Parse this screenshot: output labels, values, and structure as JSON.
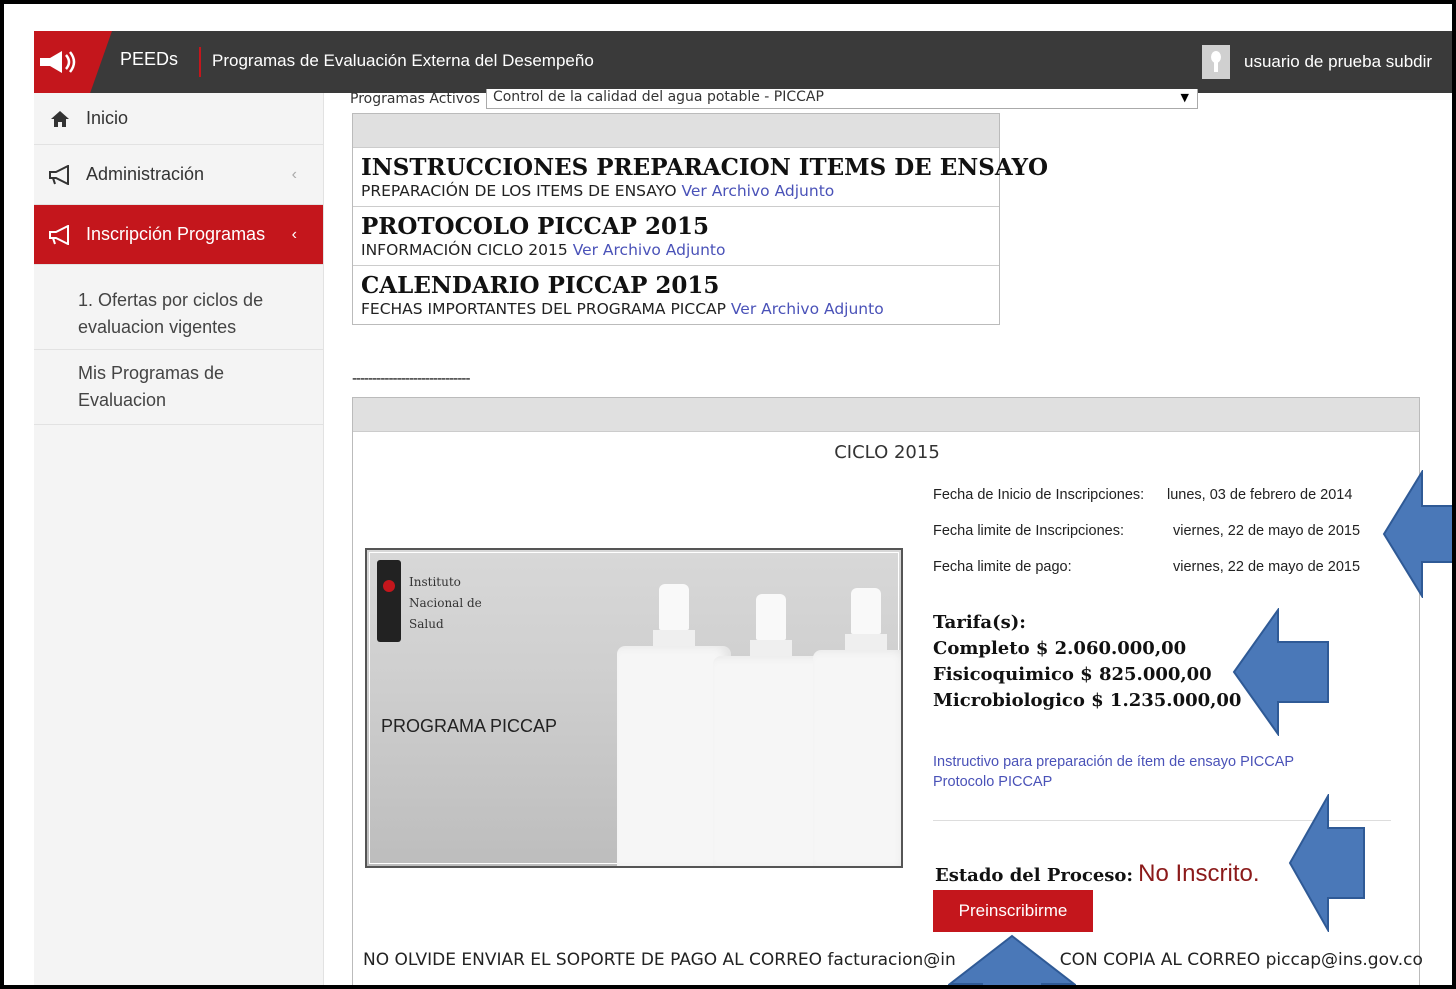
{
  "header": {
    "brand": "PEEDs",
    "subtitle": "Programas de Evaluación Externa del Desempeño",
    "user": "usuario de prueba subdir",
    "colors": {
      "bar": "#3a3a3a",
      "accent": "#c4161c"
    }
  },
  "sidebar": {
    "items": [
      {
        "label": "Inicio",
        "icon": "home-icon"
      },
      {
        "label": "Administración",
        "icon": "megaphone-icon"
      },
      {
        "label": "Inscripción Programas",
        "icon": "megaphone-icon",
        "active": true
      }
    ],
    "subitems": [
      {
        "label": "1. Ofertas por ciclos de evaluacion vigentes"
      },
      {
        "label": "Mis Programas de Evaluacion"
      }
    ]
  },
  "programs": {
    "label": "Programas Activos",
    "selected": "Control de la calidad del agua potable - PICCAP"
  },
  "documents": [
    {
      "title": "INSTRUCCIONES PREPARACION ITEMS DE ENSAYO",
      "desc": "PREPARACIÓN DE LOS ITEMS DE ENSAYO",
      "link": "Ver Archivo Adjunto"
    },
    {
      "title": "PROTOCOLO PICCAP 2015",
      "desc": "INFORMACIÓN CICLO 2015",
      "link": "Ver Archivo Adjunto"
    },
    {
      "title": "CALENDARIO PICCAP 2015",
      "desc": "FECHAS IMPORTANTES DEL PROGRAMA PICCAP",
      "link": "Ver Archivo Adjunto"
    }
  ],
  "separator": "-----------------------------",
  "ciclo": {
    "title": "CICLO 2015",
    "image": {
      "institute": [
        "Instituto",
        "Nacional de",
        "Salud"
      ],
      "label": "PROGRAMA PICCAP"
    },
    "dates": [
      {
        "label": "Fecha de Inicio de Inscripciones:",
        "value": "lunes, 03 de febrero de 2014"
      },
      {
        "label": "Fecha limite de Inscripciones:",
        "value": "viernes, 22 de mayo de 2015"
      },
      {
        "label": "Fecha limite de pago:",
        "value": "viernes, 22 de mayo de 2015"
      }
    ],
    "tarifas_title": "Tarifa(s):",
    "tarifas": [
      "Completo $ 2.060.000,00",
      "Fisicoquimico $ 825.000,00",
      "Microbiologico $ 1.235.000,00"
    ],
    "links": [
      "Instructivo para preparación de ítem de ensayo PICCAP",
      "Protocolo PICCAP"
    ],
    "estado_label": "Estado del Proceso:",
    "estado_value": "No Inscrito.",
    "button": "Preinscribirme",
    "note_left": "NO OLVIDE ENVIAR EL SOPORTE DE PAGO AL CORREO facturacion@in",
    "note_right": "CON COPIA AL CORREO piccap@ins.gov.co"
  },
  "annotation_arrow_color": "#4a78b8"
}
